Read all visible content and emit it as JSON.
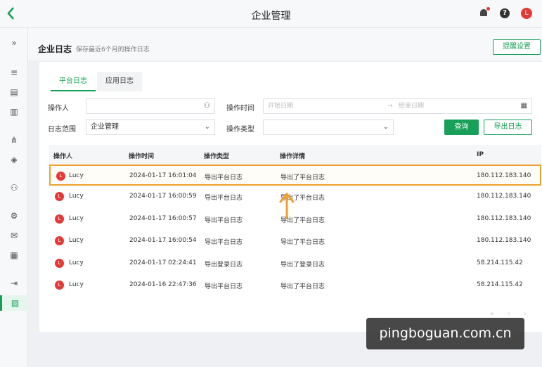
{
  "app": {
    "back_icon": "chevron-left-icon",
    "title": "企业管理",
    "avatar_letter": "L",
    "help_label": "?"
  },
  "sidebar": {
    "collapse": "»",
    "items": [
      "layers-icon",
      "clipboard-icon",
      "book-icon",
      "org-icon",
      "app-icon",
      "user-icon",
      "gear-icon",
      "mail-icon",
      "calendar-icon",
      "export-icon",
      "log-icon"
    ]
  },
  "header": {
    "title": "企业日志",
    "subtitle": "保存最近6个月的操作日志",
    "remind_button": "提醒设置"
  },
  "tabs": [
    {
      "label": "平台日志",
      "active": true
    },
    {
      "label": "应用日志",
      "active": false
    }
  ],
  "filters": {
    "operator_label": "操作人",
    "operator_value": "",
    "time_label": "操作时间",
    "start_placeholder": "开始日期",
    "date_sep": "→",
    "end_placeholder": "结束日期",
    "scope_label": "日志范围",
    "scope_value": "企业管理",
    "type_label": "操作类型",
    "type_value": "",
    "query_button": "查询",
    "export_button": "导出日志"
  },
  "table": {
    "columns": [
      "操作人",
      "操作时间",
      "操作类型",
      "操作详情",
      "IP"
    ],
    "rows": [
      {
        "avatar": "L",
        "user": "Lucy",
        "time": "2024-01-17 16:01:04",
        "type": "导出平台日志",
        "detail": "导出了平台日志",
        "ip": "180.112.183.140",
        "selected": true
      },
      {
        "avatar": "L",
        "user": "Lucy",
        "time": "2024-01-17 16:00:59",
        "type": "导出平台日志",
        "detail": "导出了平台日志",
        "ip": "180.112.183.140"
      },
      {
        "avatar": "L",
        "user": "Lucy",
        "time": "2024-01-17 16:00:57",
        "type": "导出平台日志",
        "detail": "导出了平台日志",
        "ip": "180.112.183.140"
      },
      {
        "avatar": "L",
        "user": "Lucy",
        "time": "2024-01-17 16:00:54",
        "type": "导出平台日志",
        "detail": "导出了平台日志",
        "ip": "180.112.183.140"
      },
      {
        "avatar": "L",
        "user": "Lucy",
        "time": "2024-01-17 02:24:41",
        "type": "导出登录日志",
        "detail": "导出了登录日志",
        "ip": "58.214.115.42"
      },
      {
        "avatar": "L",
        "user": "Lucy",
        "time": "2024-01-16 22:47:36",
        "type": "导出平台日志",
        "detail": "导出了平台日志",
        "ip": "58.214.115.42"
      }
    ]
  },
  "pager": "« ‹ ›",
  "watermark": "pingboguan.com.cn",
  "colors": {
    "accent": "#18a058",
    "highlight": "#f0a030",
    "avatar": "#e53935"
  }
}
